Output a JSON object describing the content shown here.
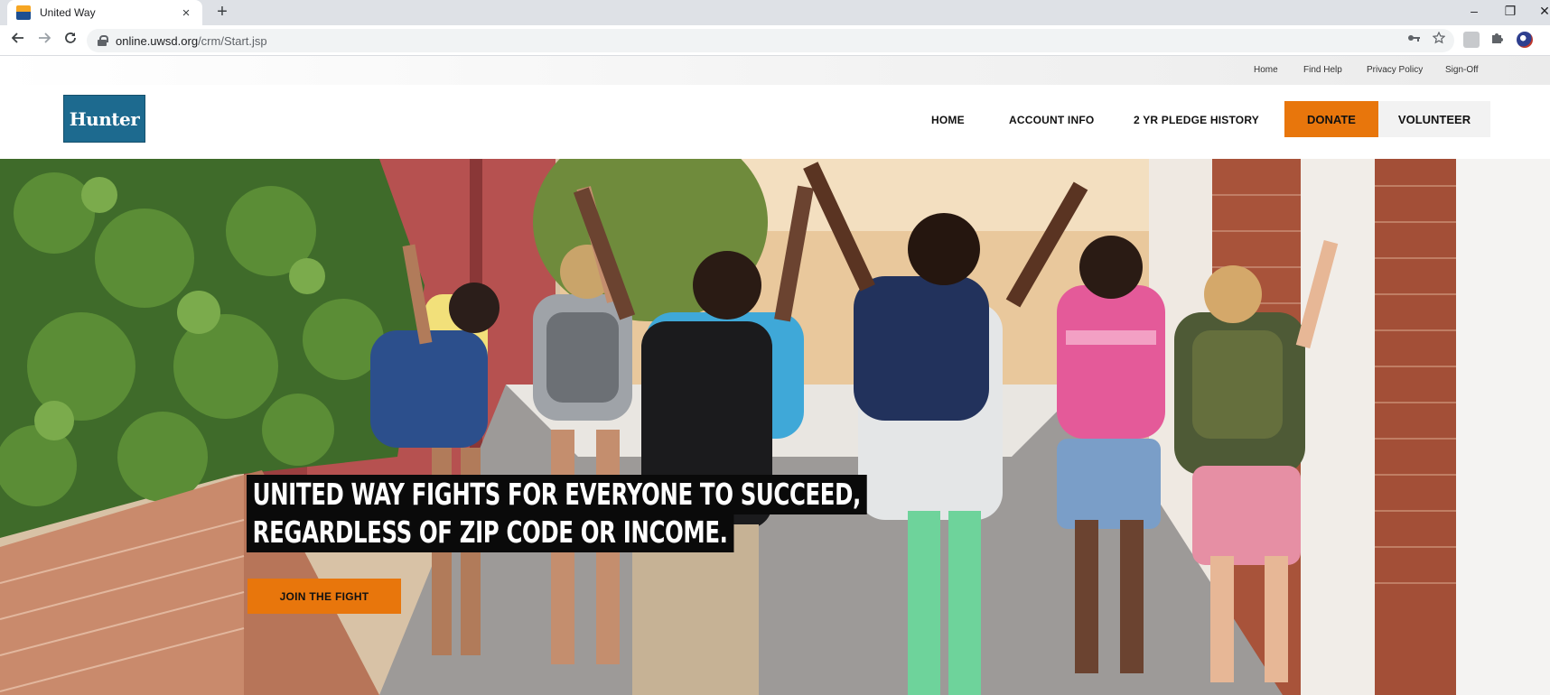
{
  "browser": {
    "tab_title": "United Way",
    "tab_close": "×",
    "new_tab": "+",
    "url_host": "online.uwsd.org",
    "url_path": "/crm/Start.jsp",
    "minimize": "–",
    "restore": "❐",
    "close": "✕"
  },
  "utility_nav": {
    "home": "Home",
    "find_help": "Find Help",
    "privacy_policy": "Privacy Policy",
    "sign_off": "Sign-Off"
  },
  "header": {
    "logo_text": "Hunter",
    "nav": {
      "home": "HOME",
      "account_info": "ACCOUNT INFO",
      "pledge_history": "2 YR PLEDGE HISTORY"
    },
    "donate": "DONATE",
    "volunteer": "VOLUNTEER"
  },
  "hero": {
    "headline_line1": "UNITED WAY FIGHTS FOR EVERYONE TO SUCCEED,",
    "headline_line2": "REGARDLESS OF ZIP CODE OR INCOME.",
    "cta": "JOIN THE FIGHT"
  },
  "colors": {
    "accent": "#e8760c",
    "logo_bg": "#1d6a8f"
  },
  "icons": [
    "favicon",
    "back-icon",
    "forward-icon",
    "reload-icon",
    "lock-icon",
    "key-icon",
    "star-icon",
    "extension-icon",
    "puzzle-icon",
    "profile-icon"
  ]
}
